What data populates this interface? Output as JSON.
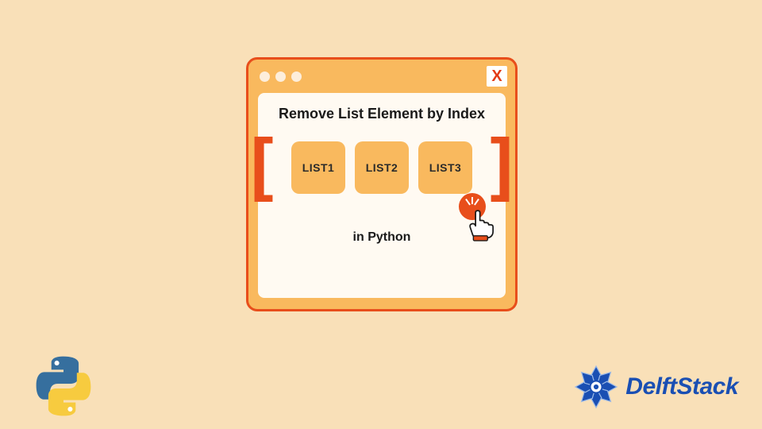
{
  "window": {
    "close_symbol": "X"
  },
  "content": {
    "heading": "Remove List Element by Index",
    "subheading": "in Python",
    "list_items": [
      "LIST1",
      "LIST2",
      "LIST3"
    ],
    "bracket_open": "[",
    "bracket_close": "]"
  },
  "brand": {
    "name": "DelftStack"
  },
  "icons": {
    "python": "python-logo",
    "brand": "delftstack-logo",
    "cursor": "pointer-hand"
  },
  "colors": {
    "background": "#f9e0b8",
    "accent": "#e84e1b",
    "chip": "#f9b95e",
    "panel": "#fffaf2",
    "brand_blue": "#1a4fb3"
  }
}
